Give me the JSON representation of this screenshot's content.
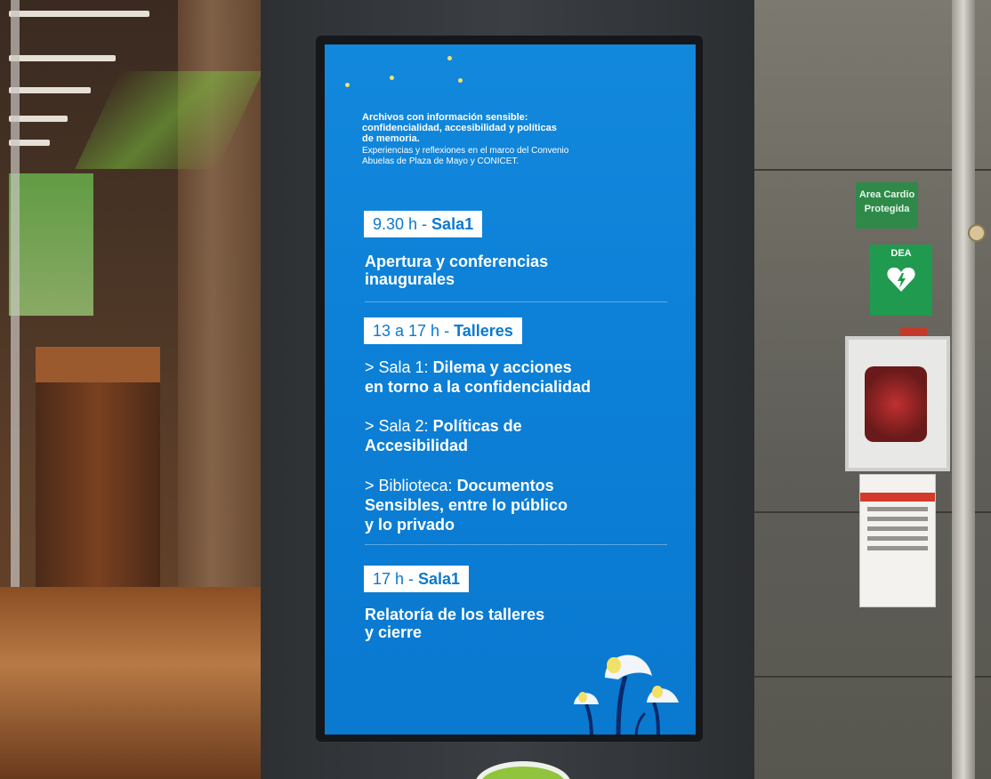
{
  "display": {
    "intro_title_lines": [
      "Archivos con información sensible:",
      "confidencialidad, accesibilidad y políticas",
      "de memoria."
    ],
    "intro_sub_lines": [
      "Experiencias y reflexiones en el marco del Convenio",
      "Abuelas de Plaza de Mayo y CONICET."
    ],
    "sessions": [
      {
        "time": "9.30 h - ",
        "place": "Sala1",
        "title_lines": [
          "Apertura y conferencias",
          "inaugurales"
        ]
      },
      {
        "time": "13 a 17 h - ",
        "place": "Talleres",
        "workshops": [
          {
            "prefix": "> Sala 1: ",
            "title_lines": [
              "Dilema y acciones",
              "en torno a la confidencialidad"
            ]
          },
          {
            "prefix": "> Sala 2: ",
            "title_lines": [
              "Políticas de",
              "Accesibilidad"
            ]
          },
          {
            "prefix": "> Biblioteca: ",
            "title_lines": [
              "Documentos",
              "Sensibles, entre lo público",
              "y lo privado"
            ]
          }
        ]
      },
      {
        "time": "17 h - ",
        "place": "Sala1",
        "title_lines": [
          "Relatoría de los talleres",
          "y cierre"
        ]
      }
    ]
  },
  "wall_signs": {
    "area_sign_lines": [
      "Area Cardio",
      "Protegida"
    ],
    "dea_label": "DEA"
  },
  "colors": {
    "screen_blue": "#0c7fd6",
    "badge_text": "#0a79d0"
  }
}
